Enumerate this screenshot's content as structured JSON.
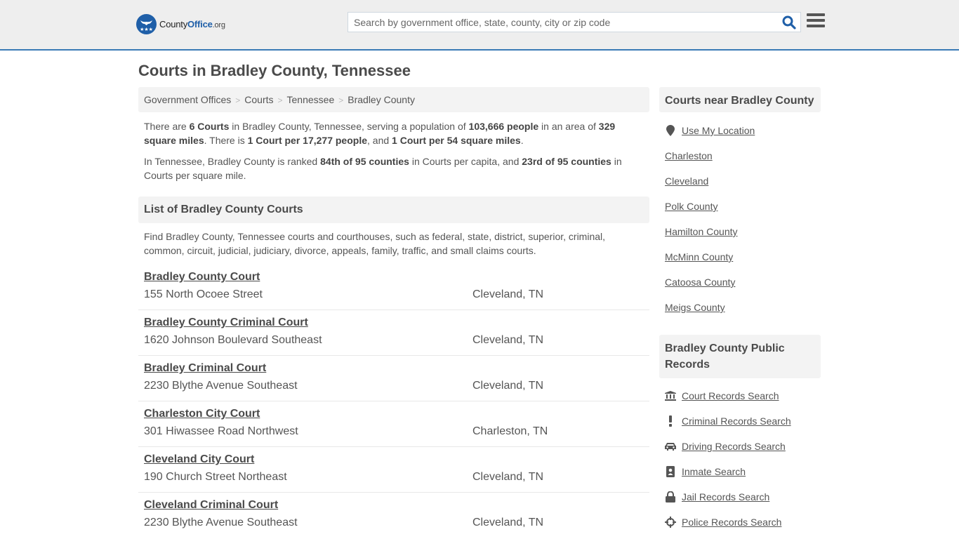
{
  "header": {
    "logo": {
      "county": "County",
      "office": "Office",
      "org": ".org"
    },
    "search": {
      "placeholder": "Search by government office, state, county, city or zip code",
      "value": ""
    },
    "colors": {
      "brand": "#1f5fa8",
      "accent_border": "#3a7ab5"
    }
  },
  "page_title": "Courts in Bradley County, Tennessee",
  "breadcrumb": [
    "Government Offices",
    "Courts",
    "Tennessee",
    "Bradley County"
  ],
  "intro": {
    "p1": {
      "t1": "There are ",
      "b1": "6 Courts",
      "t2": " in Bradley County, Tennessee, serving a population of ",
      "b2": "103,666 people",
      "t3": " in an area of ",
      "b3": "329 square miles",
      "t4": ". There is ",
      "b4": "1 Court per 17,277 people",
      "t5": ", and ",
      "b5": "1 Court per 54 square miles",
      "t6": "."
    },
    "p2": {
      "t1": "In Tennessee, Bradley County is ranked ",
      "b1": "84th of 95 counties",
      "t2": " in Courts per capita, and ",
      "b2": "23rd of 95 counties",
      "t3": " in Courts per square mile."
    }
  },
  "list_section": {
    "heading": "List of Bradley County Courts",
    "description": "Find Bradley County, Tennessee courts and courthouses, such as federal, state, district, superior, criminal, common, circuit, judicial, judiciary, divorce, appeals, family, traffic, and small claims courts.",
    "courts": [
      {
        "name": "Bradley County Court",
        "address": "155 North Ocoee Street",
        "city": "Cleveland, TN"
      },
      {
        "name": "Bradley County Criminal Court",
        "address": "1620 Johnson Boulevard Southeast",
        "city": "Cleveland, TN"
      },
      {
        "name": "Bradley Criminal Court",
        "address": "2230 Blythe Avenue Southeast",
        "city": "Cleveland, TN"
      },
      {
        "name": "Charleston City Court",
        "address": "301 Hiwassee Road Northwest",
        "city": "Charleston, TN"
      },
      {
        "name": "Cleveland City Court",
        "address": "190 Church Street Northeast",
        "city": "Cleveland, TN"
      },
      {
        "name": "Cleveland Criminal Court",
        "address": "2230 Blythe Avenue Southeast",
        "city": "Cleveland, TN"
      }
    ]
  },
  "sidebar": {
    "nearby": {
      "heading": "Courts near Bradley County",
      "use_location": {
        "label": "Use My Location",
        "icon": "map-marker-icon"
      },
      "links": [
        "Charleston",
        "Cleveland",
        "Polk County",
        "Hamilton County",
        "McMinn County",
        "Catoosa County",
        "Meigs County"
      ]
    },
    "records": {
      "heading": "Bradley County Public Records",
      "links": [
        {
          "label": "Court Records Search",
          "icon": "courthouse-icon"
        },
        {
          "label": "Criminal Records Search",
          "icon": "exclamation-icon"
        },
        {
          "label": "Driving Records Search",
          "icon": "car-icon"
        },
        {
          "label": "Inmate Search",
          "icon": "id-badge-icon"
        },
        {
          "label": "Jail Records Search",
          "icon": "lock-icon"
        },
        {
          "label": "Police Records Search",
          "icon": "crosshairs-icon"
        }
      ]
    }
  }
}
